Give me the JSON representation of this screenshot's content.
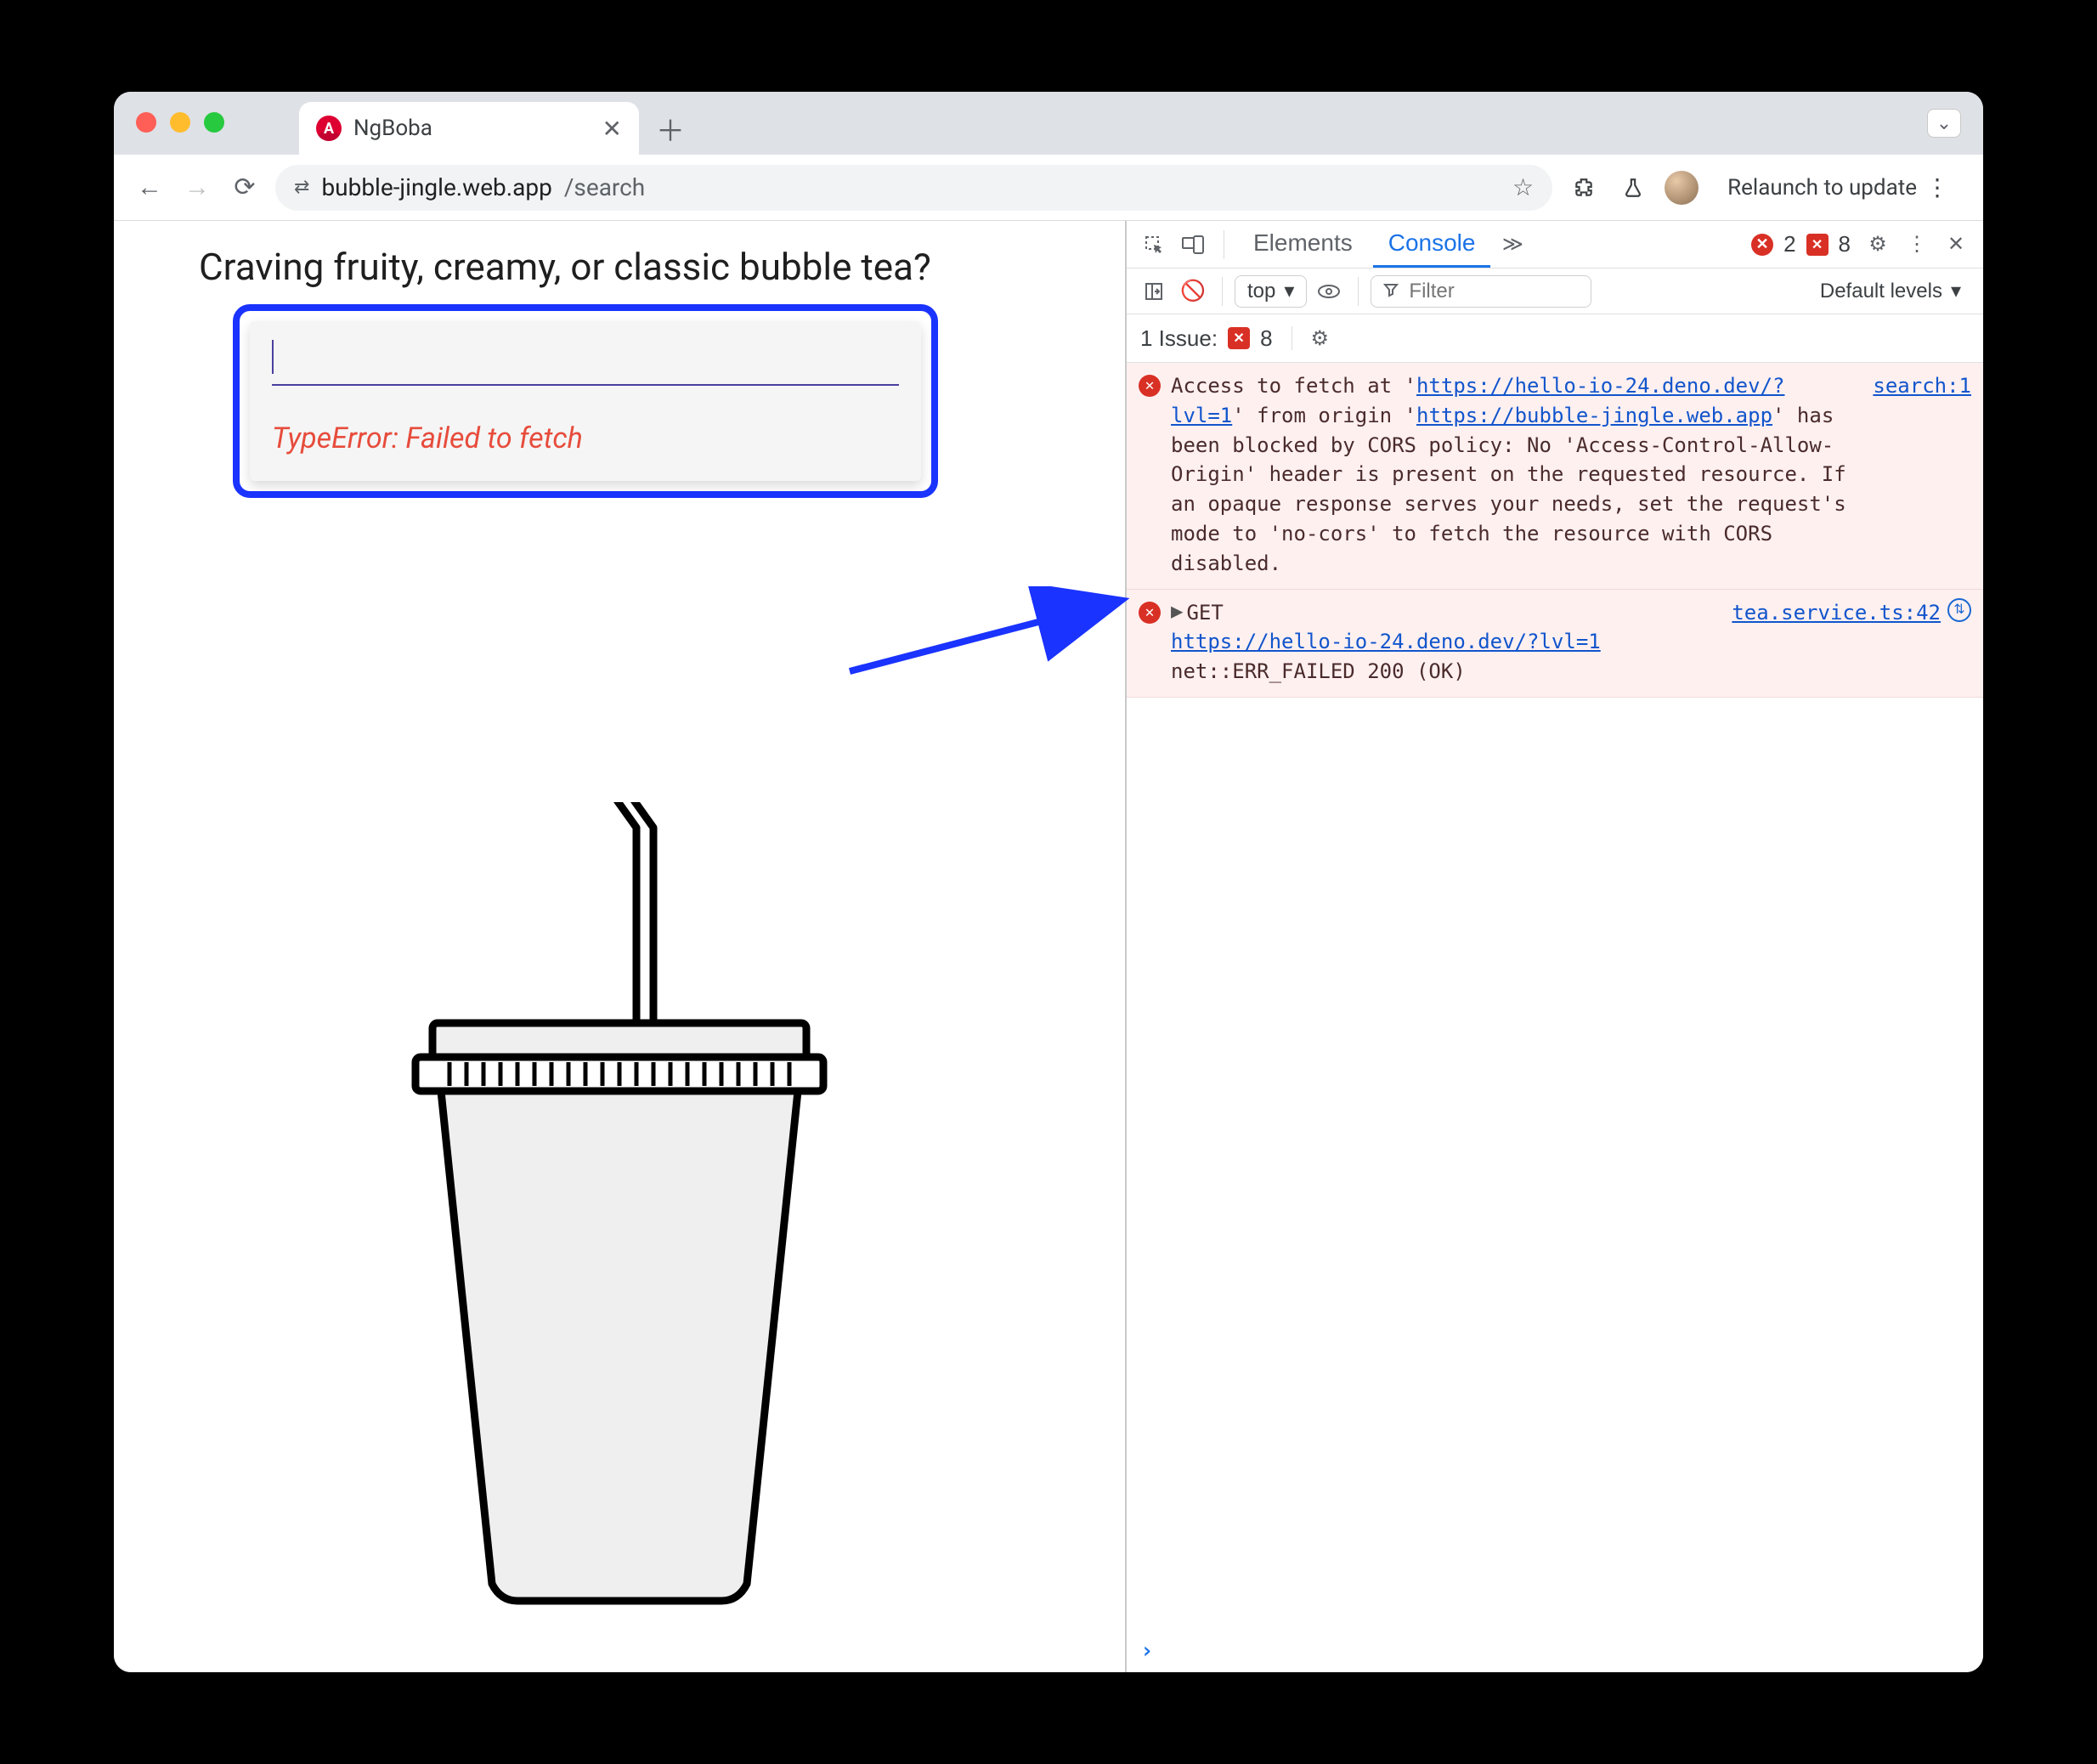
{
  "browser": {
    "tab_title": "NgBoba",
    "url_host": "bubble-jingle.web.app",
    "url_path": "/search",
    "relaunch_label": "Relaunch to update"
  },
  "page": {
    "heading": "Craving fruity, creamy, or classic bubble tea?",
    "search_value": "",
    "error_text": "TypeError: Failed to fetch"
  },
  "devtools": {
    "tabs": {
      "elements": "Elements",
      "console": "Console"
    },
    "error_count": "2",
    "issue_count": "8",
    "context_label": "top",
    "filter_placeholder": "Filter",
    "levels_label": "Default levels",
    "issues_label": "1 Issue:",
    "issues_badge_count": "8",
    "logs": [
      {
        "kind": "cors",
        "source": "search:1",
        "text_pre": "Access to fetch at '",
        "url1": "https://hello-io-24.deno.dev/?lvl=1",
        "text_mid": "' from origin '",
        "url2": "https://bubble-jingle.web.app",
        "text_post": "' has been blocked by CORS policy: No 'Access-Control-Allow-Origin' header is present on the requested resource. If an opaque response serves your needs, set the request's mode to 'no-cors' to fetch the resource with CORS disabled."
      },
      {
        "kind": "neterr",
        "source": "tea.service.ts:42",
        "method": "GET",
        "url": "https://hello-io-24.deno.dev/?lvl=1",
        "tail": " net::ERR_FAILED 200 (OK)"
      }
    ]
  }
}
